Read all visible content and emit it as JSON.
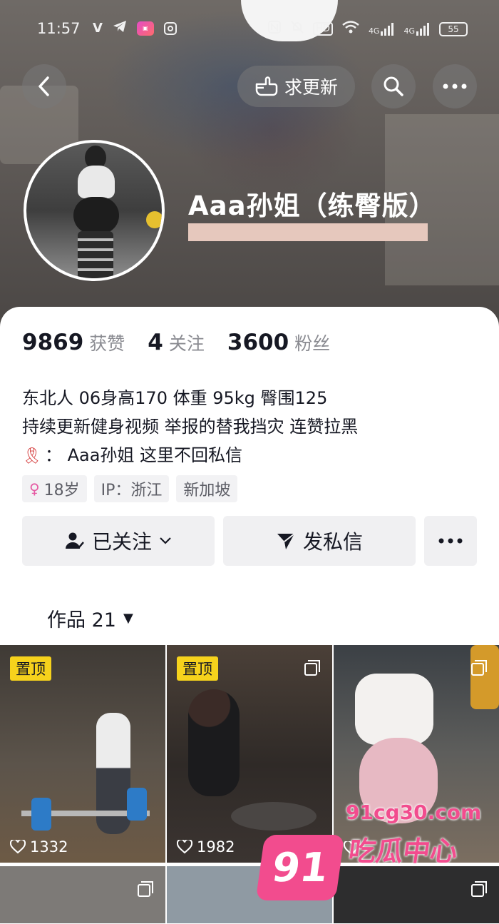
{
  "status_bar": {
    "time": "11:57",
    "left_icons": [
      "v-icon",
      "telegram-icon",
      "app-icon",
      "instagram-icon"
    ],
    "right_icons": [
      "nfc-icon",
      "mute-icon",
      "hd-icon",
      "wifi-icon",
      "4g-signal-icon",
      "4g-signal-icon"
    ],
    "network_1": "4G",
    "network_2": "4G",
    "battery": "55"
  },
  "top_bar": {
    "request_update_label": "求更新"
  },
  "profile": {
    "name": "Aaa孙姐（练臀版）"
  },
  "stats": {
    "likes_count": "9869",
    "likes_label": "获赞",
    "following_count": "4",
    "following_label": "关注",
    "followers_count": "3600",
    "followers_label": "粉丝"
  },
  "bio": {
    "line1": "东北人  06身高170 体重 95kg 臀围125",
    "line2": "持续更新健身视频 举报的替我挡灾 连赞拉黑",
    "line3": "：  Aaa孙姐 这里不回私信"
  },
  "tags": {
    "age": "18岁",
    "ip": "IP：浙江",
    "location": "新加坡"
  },
  "actions": {
    "follow_label": "已关注",
    "message_label": "发私信"
  },
  "works_tab": {
    "label": "作品 21"
  },
  "videos": [
    {
      "pinned_label": "置顶",
      "likes": "1332"
    },
    {
      "pinned_label": "置顶",
      "likes": "1982"
    },
    {
      "likes": ""
    }
  ],
  "watermark": {
    "badge": "91",
    "url": "91cg30.com",
    "text": "吃瓜中心"
  },
  "colors": {
    "pin_badge": "#f6d21c",
    "watermark": "#f24c8e"
  }
}
